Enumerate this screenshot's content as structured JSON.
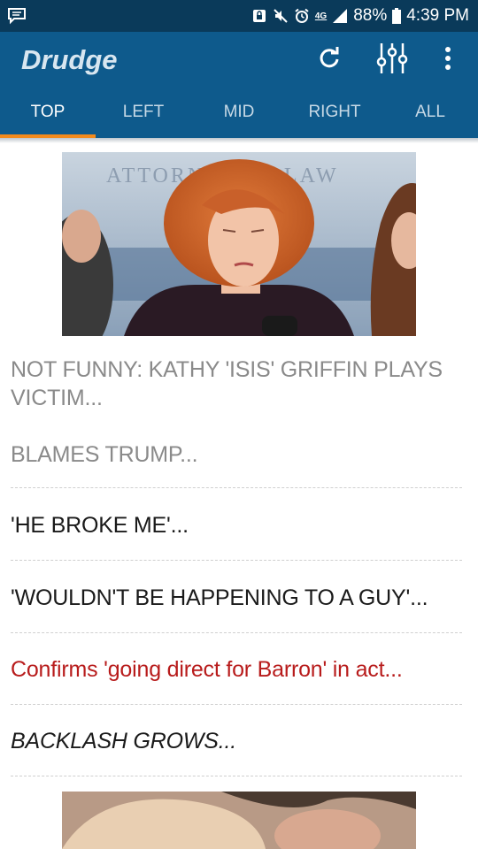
{
  "status_bar": {
    "network": "4G",
    "battery": "88%",
    "time": "4:39 PM"
  },
  "app_bar": {
    "title": "Drudge",
    "actions": [
      "refresh-icon",
      "equalizer-icon",
      "overflow-menu-icon"
    ]
  },
  "tabs": [
    {
      "label": "TOP",
      "active": true
    },
    {
      "label": "LEFT",
      "active": false
    },
    {
      "label": "MID",
      "active": false
    },
    {
      "label": "RIGHT",
      "active": false
    },
    {
      "label": "ALL",
      "active": false
    }
  ],
  "colors": {
    "status_bar": "#0a3a5a",
    "app_bar": "#0e5a8c",
    "tab_indicator": "#f28a1c",
    "visited_link": "#8a8a8a",
    "link": "#1a1a1a",
    "highlight_link": "#b81c1c"
  },
  "hero_image": {
    "sign_text": "ATTORNEY AT LAW"
  },
  "headlines": [
    {
      "text": "NOT FUNNY: KATHY 'ISIS' GRIFFIN PLAYS VICTIM...",
      "style": "visited"
    },
    {
      "text": "BLAMES TRUMP...",
      "style": "visited"
    },
    {
      "text": "'HE BROKE ME'...",
      "style": "normal"
    },
    {
      "text": "'WOULDN'T BE HAPPENING TO A GUY'...",
      "style": "normal"
    },
    {
      "text": "Confirms 'going direct for Barron' in act...",
      "style": "red"
    },
    {
      "text": "BACKLASH GROWS...",
      "style": "italic"
    }
  ]
}
